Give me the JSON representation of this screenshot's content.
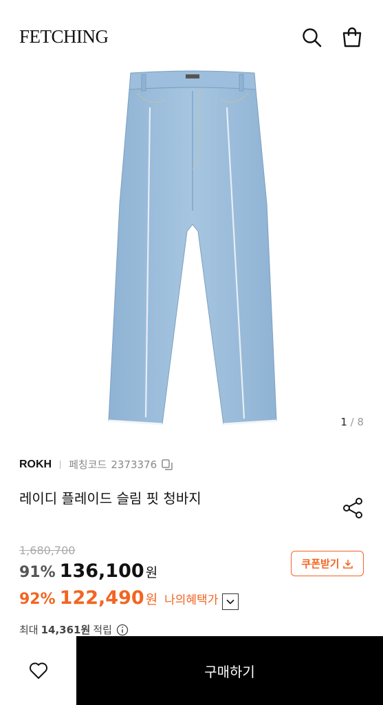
{
  "header": {
    "logo": "FETCHING",
    "search_icon": "search-icon",
    "bag_icon": "shopping-bag-icon"
  },
  "gallery": {
    "current": "1",
    "separator": " / ",
    "total": "8",
    "image": "light-blue-jeans"
  },
  "product": {
    "brand": "ROKH",
    "code_label": "페칭코드",
    "code_value": "2373376",
    "title": "레이디 플레이드 슬림 핏 청바지"
  },
  "price": {
    "original": "1,680,700",
    "discount_rate": "91%",
    "sale_price": "136,100",
    "currency": "원",
    "my_discount_rate": "92%",
    "my_price": "122,490",
    "my_benefit_label": "나의혜택가",
    "coupon_label": "쿠폰받기"
  },
  "points": {
    "prefix": "최대",
    "value": "14,361원",
    "suffix": "적립"
  },
  "bottom": {
    "buy_label": "구매하기",
    "wish_icon": "heart-icon"
  },
  "colors": {
    "accent": "#f26522",
    "buy_bg": "#000000"
  }
}
